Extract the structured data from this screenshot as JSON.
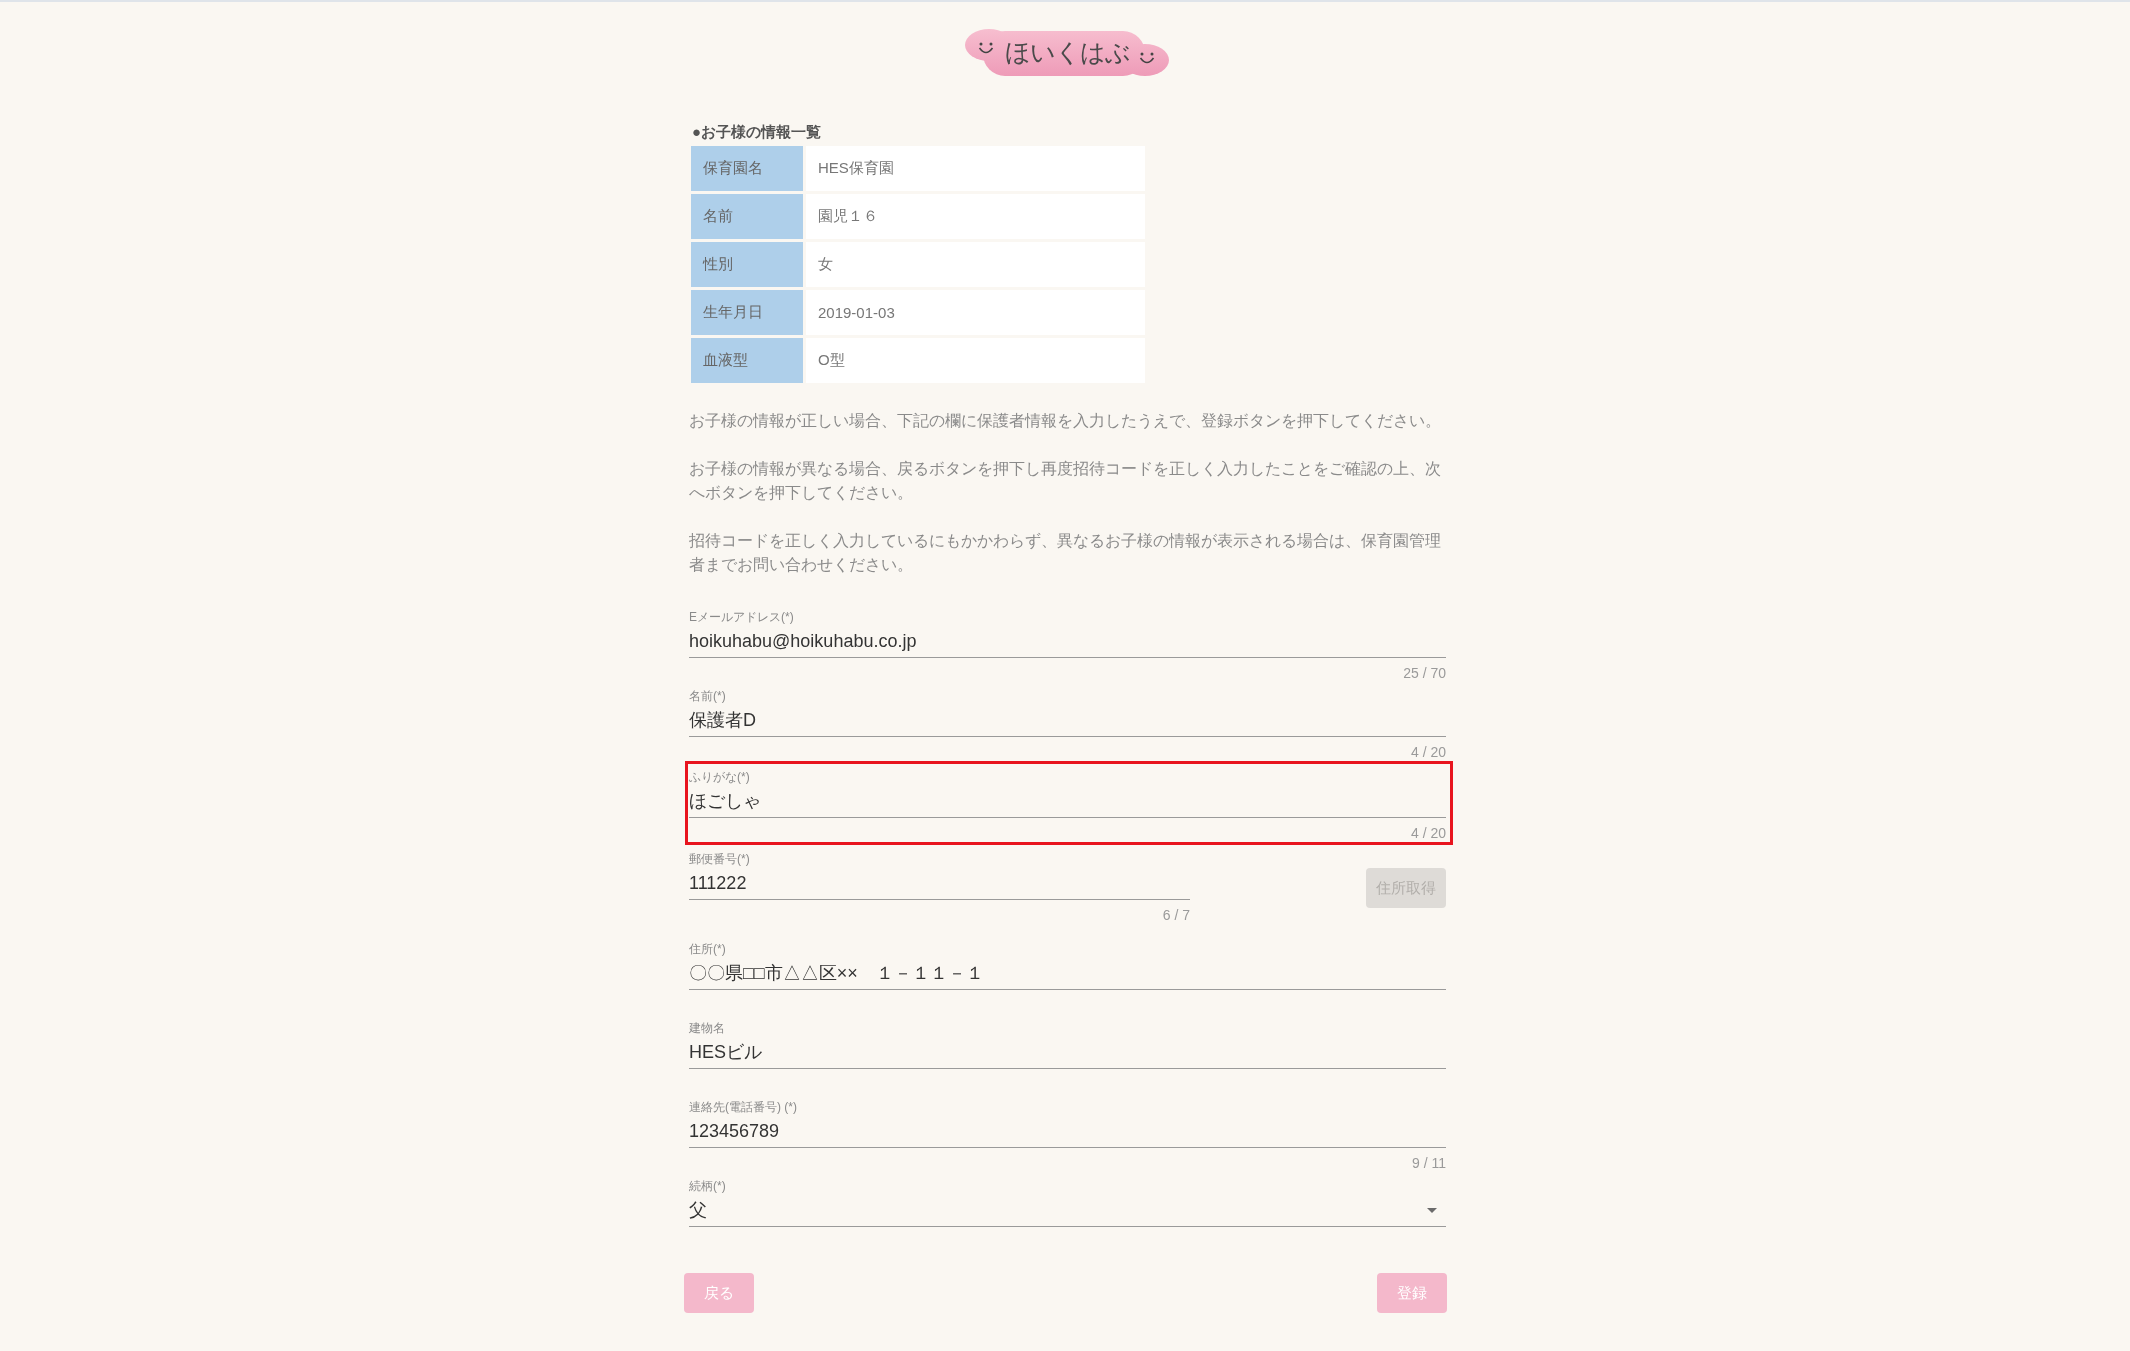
{
  "logo": {
    "text": "ほいくはぶ"
  },
  "child_info": {
    "title": "●お子様の情報一覧",
    "rows": [
      {
        "label": "保育園名",
        "value": "HES保育園"
      },
      {
        "label": "名前",
        "value": "園児１６"
      },
      {
        "label": "性別",
        "value": "女"
      },
      {
        "label": "生年月日",
        "value": "2019-01-03"
      },
      {
        "label": "血液型",
        "value": "O型"
      }
    ]
  },
  "notes": [
    "お子様の情報が正しい場合、下記の欄に保護者情報を入力したうえで、登録ボタンを押下してください。",
    "お子様の情報が異なる場合、戻るボタンを押下し再度招待コードを正しく入力したことをご確認の上、次へボタンを押下してください。",
    "招待コードを正しく入力しているにもかかわらず、異なるお子様の情報が表示される場合は、保育園管理者までお問い合わせください。"
  ],
  "fields": [
    {
      "kind": "text",
      "label": "Eメールアドレス(*)",
      "value": "hoikuhabu@hoikuhabu.co.jp",
      "counter": "25 / 70",
      "highlighted": false
    },
    {
      "kind": "text",
      "label": "名前(*)",
      "value": "保護者D",
      "counter": "4 / 20",
      "highlighted": false
    },
    {
      "kind": "text",
      "label": "ふりがな(*)",
      "value": "ほごしゃ",
      "counter": "4 / 20",
      "highlighted": true
    },
    {
      "kind": "postal",
      "label": "郵便番号(*)",
      "value": "111222",
      "counter": "6 / 7",
      "highlighted": false,
      "button": {
        "label": "住所取得",
        "disabled": true
      }
    },
    {
      "kind": "text",
      "label": "住所(*)",
      "value": "〇〇県□□市△△区××　１－１１－１",
      "highlighted": false
    },
    {
      "kind": "text",
      "label": "建物名",
      "value": "HESビル",
      "highlighted": false
    },
    {
      "kind": "text",
      "label": "連絡先(電話番号) (*)",
      "value": "123456789",
      "counter": "9 / 11",
      "highlighted": false
    },
    {
      "kind": "select",
      "label": "続柄(*)",
      "value": "父",
      "highlighted": false
    }
  ],
  "buttons": [
    {
      "label": "戻る"
    },
    {
      "label": "登録"
    }
  ]
}
